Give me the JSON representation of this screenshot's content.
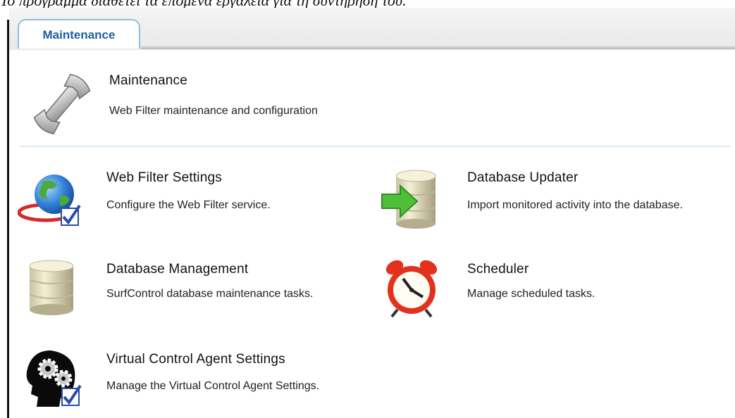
{
  "caption": "Το πρόγραμμα διαθέτει τα επόμενα εργαλεία για τη συντήρησή του.",
  "tab": {
    "label": "Maintenance"
  },
  "header": {
    "title": "Maintenance",
    "description": "Web Filter maintenance and configuration"
  },
  "tools": {
    "web_filter_settings": {
      "title": "Web Filter Settings",
      "description": "Configure the Web Filter service."
    },
    "database_updater": {
      "title": "Database Updater",
      "description": "Import monitored activity into the database."
    },
    "database_management": {
      "title": "Database Management",
      "description": "SurfControl database maintenance tasks."
    },
    "scheduler": {
      "title": "Scheduler",
      "description": "Manage scheduled tasks."
    },
    "virtual_control_agent_settings": {
      "title": "Virtual Control Agent Settings",
      "description": "Manage the Virtual Control Agent Settings."
    }
  },
  "icons": {
    "header": "wrench-icon",
    "web_filter_settings": "globe-checkmark-icon",
    "database_updater": "database-arrow-icon",
    "database_management": "database-icon",
    "scheduler": "alarm-clock-icon",
    "virtual_control_agent_settings": "head-gears-icon"
  }
}
